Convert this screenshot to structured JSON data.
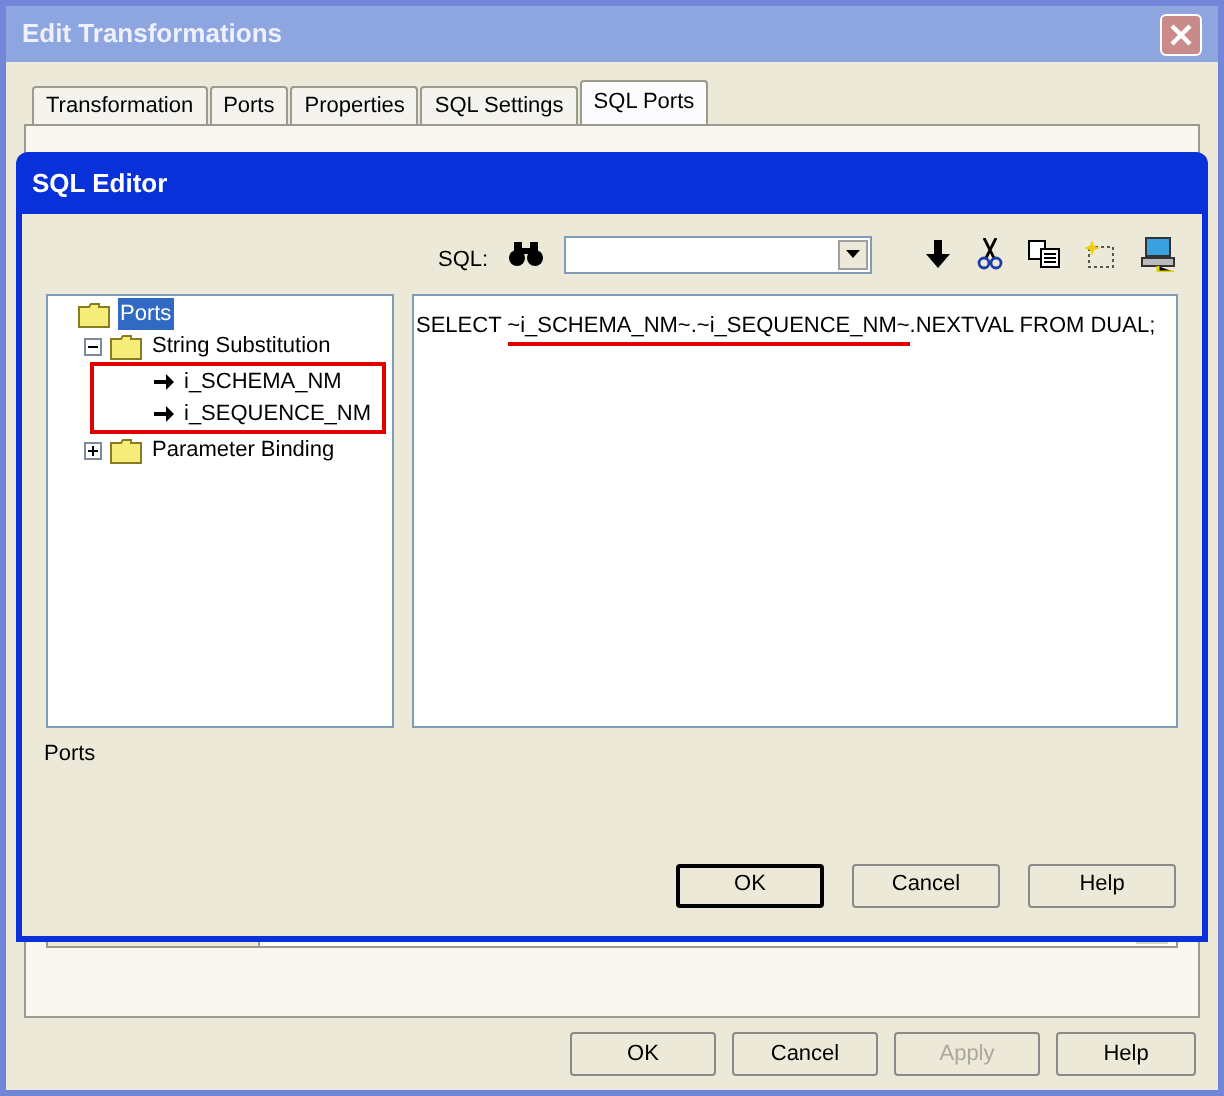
{
  "window": {
    "title": "Edit Transformations"
  },
  "tabs": [
    {
      "label": "Transformation",
      "selected": false
    },
    {
      "label": "Ports",
      "selected": false
    },
    {
      "label": "Properties",
      "selected": false
    },
    {
      "label": "SQL Settings",
      "selected": false
    },
    {
      "label": "SQL Ports",
      "selected": true
    }
  ],
  "buttons": [
    {
      "label": "OK",
      "disabled": false
    },
    {
      "label": "Cancel",
      "disabled": false
    },
    {
      "label": "Apply",
      "disabled": true
    },
    {
      "label": "Help",
      "disabled": false
    }
  ],
  "sql_editor": {
    "title": "SQL Editor",
    "sql_label": "SQL:",
    "tree": [
      {
        "label": "Ports",
        "kind": "folder",
        "selected": true,
        "children": [
          {
            "label": "String Substitution",
            "kind": "folder",
            "selected": false,
            "expanded": true,
            "marked": true,
            "children": [
              {
                "label": "i_SCHEMA_NM",
                "kind": "port",
                "selected": false
              },
              {
                "label": "i_SEQUENCE_NM",
                "kind": "port",
                "selected": false
              }
            ]
          },
          {
            "label": "Parameter Binding",
            "kind": "folder",
            "selected": false,
            "expanded": false
          }
        ]
      }
    ],
    "sql": [
      {
        "text": "SELECT ",
        "marked": false
      },
      {
        "text": "~i_SCHEMA_NM~.~i_SEQUENCE_NM~",
        "marked": true
      },
      {
        "text": ".NEXTVAL FROM DUAL;",
        "marked": false
      }
    ],
    "status": "Ports",
    "buttons": [
      {
        "label": "OK",
        "default": true
      },
      {
        "label": "Cancel",
        "default": false
      },
      {
        "label": "Help",
        "default": false
      }
    ]
  }
}
